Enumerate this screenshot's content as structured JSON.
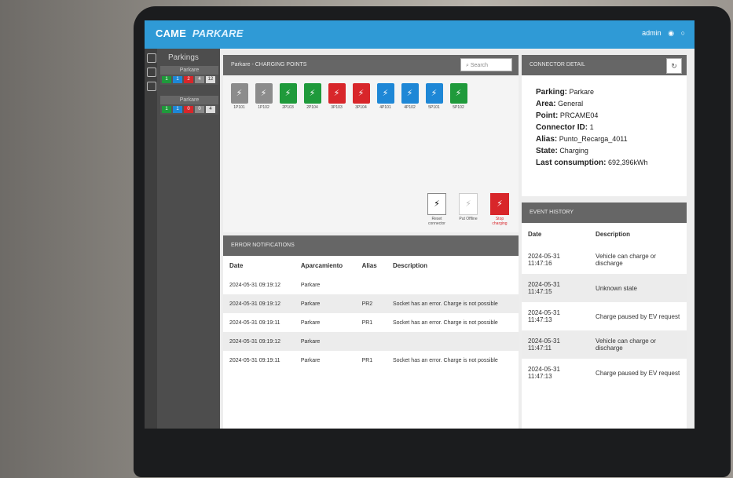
{
  "app": {
    "brand_came": "CAME",
    "brand_parkare": "PARKARE",
    "user": "admin"
  },
  "sidebar": {
    "title": "Parkings",
    "blocks": [
      {
        "name": "Parkare",
        "counts": [
          "1",
          "1",
          "2",
          "4",
          "12"
        ]
      },
      {
        "name": "Parkare",
        "counts": [
          "1",
          "1",
          "0",
          "0",
          "4"
        ]
      }
    ]
  },
  "charging_points": {
    "title": "Parkare - CHARGING POINTS",
    "search_placeholder": "Search",
    "points": [
      {
        "id": "1P101",
        "status": "gray"
      },
      {
        "id": "1P102",
        "status": "gray"
      },
      {
        "id": "2P103",
        "status": "green"
      },
      {
        "id": "2P104",
        "status": "green"
      },
      {
        "id": "3P103",
        "status": "red"
      },
      {
        "id": "3P104",
        "status": "red"
      },
      {
        "id": "4P101",
        "status": "blue"
      },
      {
        "id": "4P102",
        "status": "blue"
      },
      {
        "id": "5P101",
        "status": "blue"
      },
      {
        "id": "5P102",
        "status": "green"
      }
    ],
    "legend": [
      {
        "label": "Reset connector",
        "style": "normal"
      },
      {
        "label": "Put Offline",
        "style": "off"
      },
      {
        "label": "Stop charging",
        "style": "stop"
      }
    ]
  },
  "connector_detail": {
    "title": "CONNECTOR DETAIL",
    "parking_label": "Parking:",
    "parking": "Parkare",
    "area_label": "Area:",
    "area": "General",
    "point_label": "Point:",
    "point": "PRCAME04",
    "connector_label": "Connector ID:",
    "connector": "1",
    "alias_label": "Alias:",
    "alias": "Punto_Recarga_4011",
    "state_label": "State:",
    "state": "Charging",
    "consumption_label": "Last consumption:",
    "consumption": "692,396kWh"
  },
  "errors": {
    "title": "ERROR NOTIFICATIONS",
    "headers": [
      "Date",
      "Aparcamiento",
      "Alias",
      "Description"
    ],
    "rows": [
      [
        "2024-05-31 09:19:12",
        "Parkare",
        "",
        ""
      ],
      [
        "2024-05-31 09:19:12",
        "Parkare",
        "PR2",
        "Socket has an error. Charge is not possible"
      ],
      [
        "2024-05-31 09:19:11",
        "Parkare",
        "PR1",
        "Socket has an error. Charge is not possible"
      ],
      [
        "2024-05-31 09:19:12",
        "Parkare",
        "",
        ""
      ],
      [
        "2024-05-31 09:19:11",
        "Parkare",
        "PR1",
        "Socket has an error. Charge is not possible"
      ]
    ]
  },
  "events": {
    "title": "EVENT HISTORY",
    "headers": [
      "Date",
      "Description"
    ],
    "rows": [
      [
        "2024-05-31 11:47:16",
        "Vehicle can charge or discharge"
      ],
      [
        "2024-05-31 11:47:15",
        "Unknown state"
      ],
      [
        "2024-05-31 11:47:13",
        "Charge paused by EV request"
      ],
      [
        "2024-05-31 11:47:11",
        "Vehicle can charge or discharge"
      ],
      [
        "2024-05-31 11:47:13",
        "Charge paused by EV request"
      ]
    ]
  }
}
